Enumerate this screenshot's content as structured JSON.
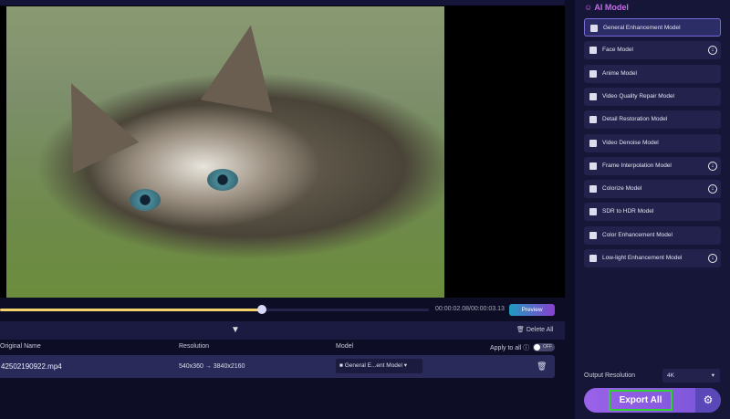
{
  "player": {
    "current_time": "00:00:02.08",
    "total_time": "00:00:03.13",
    "time_sep": "/",
    "progress": 0.61,
    "preview_label": "Preview"
  },
  "list": {
    "delete_all_label": "Delete All",
    "collapse_icon": "double-chevron-down-icon",
    "headers": {
      "name": "Original Name",
      "resolution": "Resolution",
      "model": "Model",
      "apply_all": "Apply to all"
    },
    "apply_all_toggle": "OFF",
    "rows": [
      {
        "name": "42502190922.mp4",
        "res_from": "540x360",
        "arrow": "→",
        "res_to": "3840x2160",
        "model": "General E...ent Model"
      }
    ]
  },
  "sidebar": {
    "title": "AI Model",
    "models": [
      {
        "label": "General Enhancement Model",
        "selected": true,
        "download": false
      },
      {
        "label": "Face Model",
        "download": true
      },
      {
        "label": "Anime Model",
        "download": false
      },
      {
        "label": "Video Quality Repair Model",
        "download": false
      },
      {
        "label": "Detail Restoration Model",
        "download": false
      },
      {
        "label": "Video Denoise Model",
        "download": false
      },
      {
        "label": "Frame Interpolation Model",
        "download": true
      },
      {
        "label": "Colorize Model",
        "download": true
      },
      {
        "label": "SDR to HDR Model",
        "download": false
      },
      {
        "label": "Color Enhancement Model",
        "download": false
      },
      {
        "label": "Low-light Enhancement Model",
        "download": true
      }
    ],
    "output_resolution_label": "Output Resolution",
    "output_resolution": "4K",
    "export_label": "Export All"
  },
  "colors": {
    "accent": "#8a5ce0",
    "progress": "#f3d36a",
    "highlight": "#2fd02f"
  }
}
